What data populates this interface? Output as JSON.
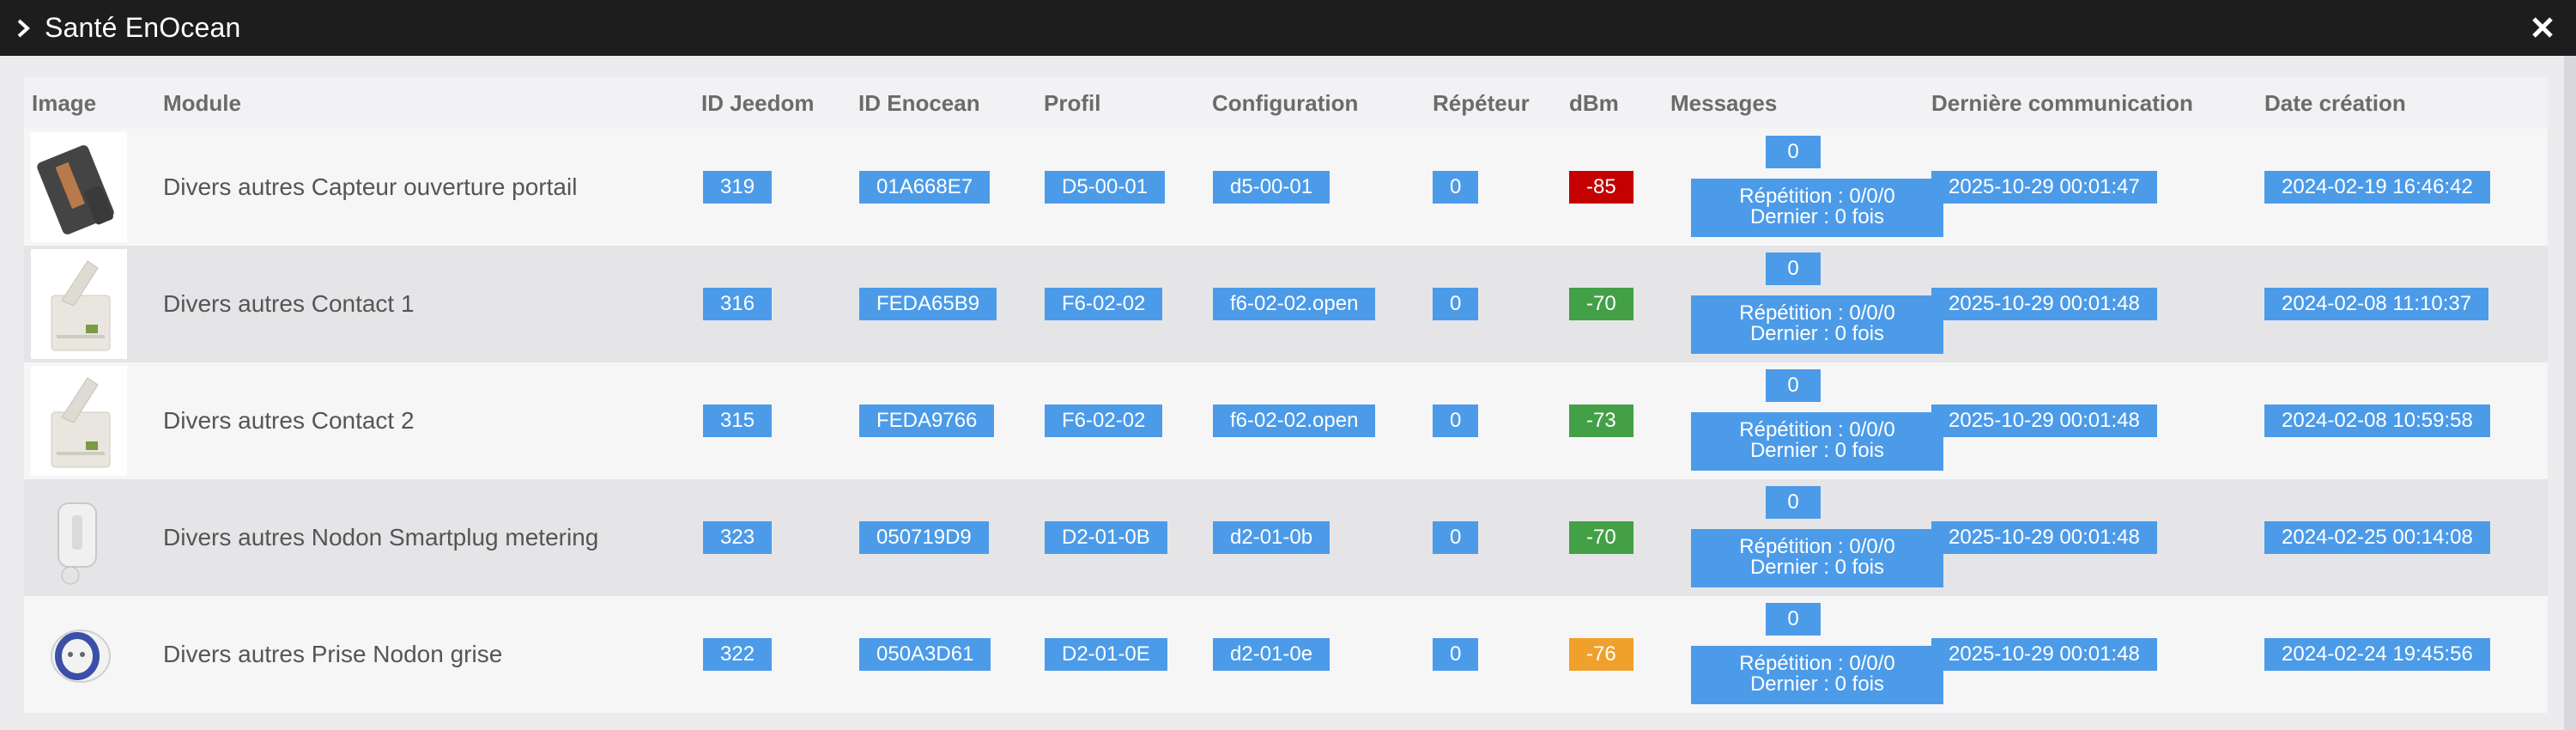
{
  "window": {
    "title": "Santé EnOcean",
    "expand_icon": "chevron-right-icon",
    "close_icon": "close-icon"
  },
  "columns": {
    "image": "Image",
    "module": "Module",
    "id_jeedom": "ID Jeedom",
    "id_enocean": "ID Enocean",
    "profil": "Profil",
    "configuration": "Configuration",
    "repeteur": "Répéteur",
    "dbm": "dBm",
    "messages": "Messages",
    "last_comm": "Dernière communication",
    "created": "Date création"
  },
  "colors": {
    "badge_blue": "#4c9be8",
    "dbm_red": "#c40000",
    "dbm_green": "#43a047",
    "dbm_orange": "#f0a02c"
  },
  "rows": [
    {
      "image": "door-sensor-image",
      "module": "Divers autres Capteur ouverture portail",
      "id_jeedom": "319",
      "id_enocean": "01A668E7",
      "profil": "D5-00-01",
      "configuration": "d5-00-01",
      "repeteur": "0",
      "dbm": "-85",
      "dbm_level": "red",
      "messages_count": "0",
      "messages_repetition": "Répétition : 0/0/0",
      "messages_last": "Dernier : 0 fois",
      "last_comm": "2025-10-29 00:01:47",
      "created": "2024-02-19 16:46:42"
    },
    {
      "image": "contact-switch-image",
      "module": "Divers autres Contact 1",
      "id_jeedom": "316",
      "id_enocean": "FEDA65B9",
      "profil": "F6-02-02",
      "configuration": "f6-02-02.open",
      "repeteur": "0",
      "dbm": "-70",
      "dbm_level": "green",
      "messages_count": "0",
      "messages_repetition": "Répétition : 0/0/0",
      "messages_last": "Dernier : 0 fois",
      "last_comm": "2025-10-29 00:01:48",
      "created": "2024-02-08 11:10:37"
    },
    {
      "image": "contact-switch-image",
      "module": "Divers autres Contact 2",
      "id_jeedom": "315",
      "id_enocean": "FEDA9766",
      "profil": "F6-02-02",
      "configuration": "f6-02-02.open",
      "repeteur": "0",
      "dbm": "-73",
      "dbm_level": "green",
      "messages_count": "0",
      "messages_repetition": "Répétition : 0/0/0",
      "messages_last": "Dernier : 0 fois",
      "last_comm": "2025-10-29 00:01:48",
      "created": "2024-02-08 10:59:58"
    },
    {
      "image": "smartplug-image",
      "module": "Divers autres Nodon Smartplug metering",
      "id_jeedom": "323",
      "id_enocean": "050719D9",
      "profil": "D2-01-0B",
      "configuration": "d2-01-0b",
      "repeteur": "0",
      "dbm": "-70",
      "dbm_level": "green",
      "messages_count": "0",
      "messages_repetition": "Répétition : 0/0/0",
      "messages_last": "Dernier : 0 fois",
      "last_comm": "2025-10-29 00:01:48",
      "created": "2024-02-25 00:14:08"
    },
    {
      "image": "plug-socket-image",
      "module": "Divers autres Prise Nodon grise",
      "id_jeedom": "322",
      "id_enocean": "050A3D61",
      "profil": "D2-01-0E",
      "configuration": "d2-01-0e",
      "repeteur": "0",
      "dbm": "-76",
      "dbm_level": "orange",
      "messages_count": "0",
      "messages_repetition": "Répétition : 0/0/0",
      "messages_last": "Dernier : 0 fois",
      "last_comm": "2025-10-29 00:01:48",
      "created": "2024-02-24 19:45:56"
    }
  ]
}
